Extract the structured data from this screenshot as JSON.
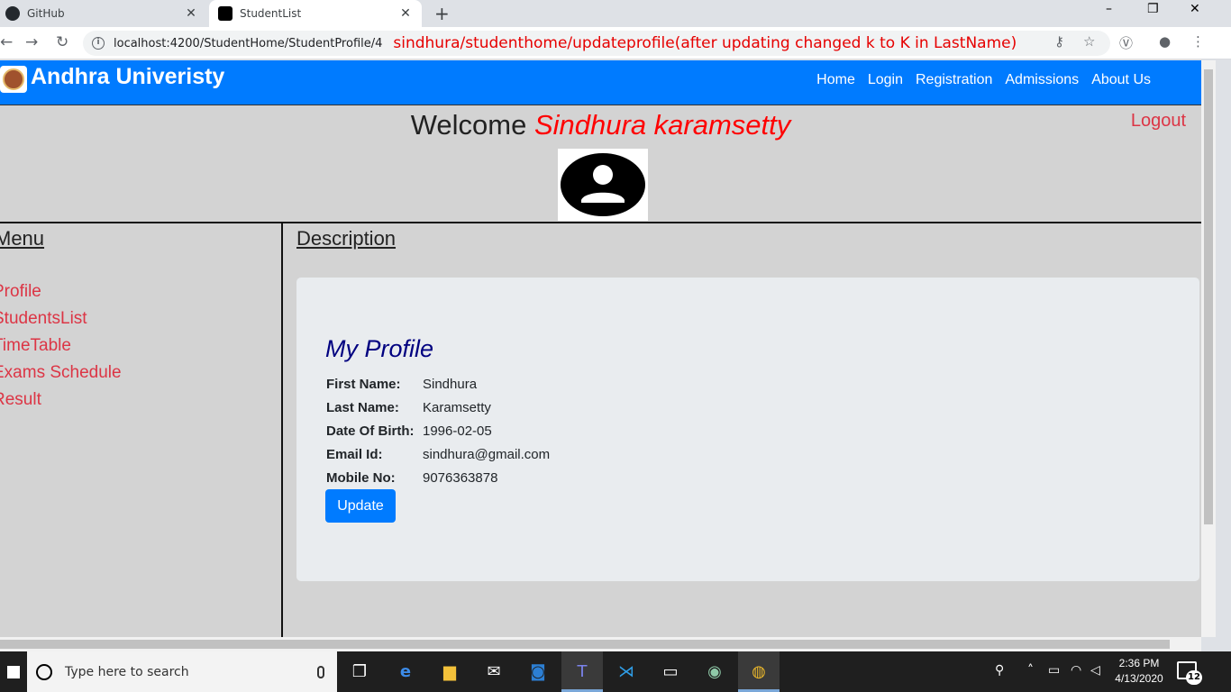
{
  "browser": {
    "tabs": [
      {
        "title": "GitHub",
        "active": false
      },
      {
        "title": "StudentList",
        "active": true
      }
    ],
    "new_tab_label": "+",
    "close_label": "✕",
    "url": "localhost:4200/StudentHome/StudentProfile/4",
    "annotation": "sindhura/studenthome/updateprofile(after updating changed k to K in LastName)",
    "window_controls": [
      "–",
      "❐",
      "✕"
    ]
  },
  "navbar": {
    "brand": "Andhra Univeristy",
    "links": [
      "Home",
      "Login",
      "Registration",
      "Admissions",
      "About Us"
    ]
  },
  "header": {
    "welcome_prefix": "Welcome",
    "user_name": "Sindhura karamsetty",
    "logout_label": "Logout"
  },
  "menu": {
    "title": "Menu",
    "items": [
      "Profile",
      "StudentsList",
      "TimeTable",
      "Exams Schedule",
      "Result"
    ]
  },
  "description": {
    "title": "Description",
    "card_title": "My Profile",
    "fields": [
      {
        "label": "First Name:",
        "value": "Sindhura"
      },
      {
        "label": "Last Name:",
        "value": "Karamsetty"
      },
      {
        "label": "Date Of Birth:",
        "value": "1996-02-05"
      },
      {
        "label": "Email Id:",
        "value": "sindhura@gmail.com"
      },
      {
        "label": "Mobile No:",
        "value": "9076363878"
      }
    ],
    "update_label": "Update"
  },
  "taskbar": {
    "search_placeholder": "Type here to search",
    "time": "2:36 PM",
    "date": "4/13/2020",
    "notification_count": "12"
  }
}
